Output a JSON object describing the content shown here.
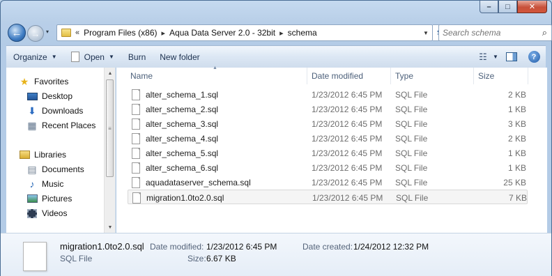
{
  "window": {
    "caption_buttons": [
      "–",
      "□",
      "✕"
    ]
  },
  "nav": {
    "back_glyph": "←",
    "forward_glyph": "→",
    "dropdown_glyph": "▾"
  },
  "address_bar": {
    "overflow": "«",
    "crumbs": [
      "Program Files (x86)",
      "Aqua Data Server 2.0 - 32bit",
      "schema"
    ],
    "separator": "▸"
  },
  "search": {
    "placeholder": "Search schema"
  },
  "toolbar": {
    "organize": "Organize",
    "open": "Open",
    "burn": "Burn",
    "new_folder": "New folder"
  },
  "nav_pane": {
    "favorites": {
      "label": "Favorites",
      "items": [
        "Desktop",
        "Downloads",
        "Recent Places"
      ]
    },
    "libraries": {
      "label": "Libraries",
      "items": [
        "Documents",
        "Music",
        "Pictures",
        "Videos"
      ]
    }
  },
  "columns": {
    "name": "Name",
    "date_modified": "Date modified",
    "type": "Type",
    "size": "Size"
  },
  "files": [
    {
      "name": "alter_schema_1.sql",
      "date": "1/23/2012 6:45 PM",
      "type": "SQL File",
      "size": "2 KB"
    },
    {
      "name": "alter_schema_2.sql",
      "date": "1/23/2012 6:45 PM",
      "type": "SQL File",
      "size": "1 KB"
    },
    {
      "name": "alter_schema_3.sql",
      "date": "1/23/2012 6:45 PM",
      "type": "SQL File",
      "size": "3 KB"
    },
    {
      "name": "alter_schema_4.sql",
      "date": "1/23/2012 6:45 PM",
      "type": "SQL File",
      "size": "2 KB"
    },
    {
      "name": "alter_schema_5.sql",
      "date": "1/23/2012 6:45 PM",
      "type": "SQL File",
      "size": "1 KB"
    },
    {
      "name": "alter_schema_6.sql",
      "date": "1/23/2012 6:45 PM",
      "type": "SQL File",
      "size": "1 KB"
    },
    {
      "name": "aquadataserver_schema.sql",
      "date": "1/23/2012 6:45 PM",
      "type": "SQL File",
      "size": "25 KB"
    },
    {
      "name": "migration1.0to2.0.sql",
      "date": "1/23/2012 6:45 PM",
      "type": "SQL File",
      "size": "7 KB"
    }
  ],
  "selected_index": 7,
  "details": {
    "name": "migration1.0to2.0.sql",
    "type": "SQL File",
    "modified_label": "Date modified:",
    "modified_value": "1/23/2012 6:45 PM",
    "created_label": "Date created:",
    "created_value": "1/24/2012 12:32 PM",
    "size_label": "Size:",
    "size_value": "6.67 KB"
  },
  "colors": {
    "accent": "#3d7bc2",
    "close": "#c7503a"
  }
}
